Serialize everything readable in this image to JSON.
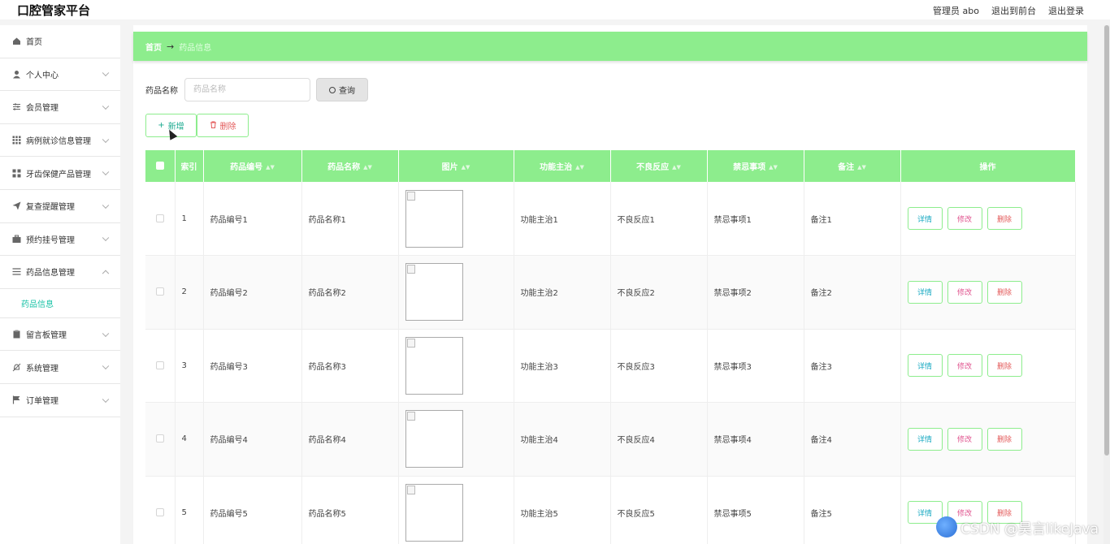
{
  "header": {
    "app_title": "口腔管家平台",
    "admin_label": "管理员 abo",
    "exit_front_label": "退出到前台",
    "logout_label": "退出登录"
  },
  "sidebar": {
    "items": [
      {
        "label": "首页",
        "icon": "home-icon",
        "chevron": false
      },
      {
        "label": "个人中心",
        "icon": "user-icon",
        "chevron": true
      },
      {
        "label": "会员管理",
        "icon": "sliders-icon",
        "chevron": true
      },
      {
        "label": "病例就诊信息管理",
        "icon": "grid-icon",
        "chevron": true
      },
      {
        "label": "牙齿保健产品管理",
        "icon": "blocks-icon",
        "chevron": true
      },
      {
        "label": "复查提醒管理",
        "icon": "send-icon",
        "chevron": true
      },
      {
        "label": "预约挂号管理",
        "icon": "briefcase-icon",
        "chevron": true
      },
      {
        "label": "药品信息管理",
        "icon": "list-icon",
        "chevron": true,
        "expanded": true
      },
      {
        "label": "留言板管理",
        "icon": "clipboard-icon",
        "chevron": true
      },
      {
        "label": "系统管理",
        "icon": "bell-off-icon",
        "chevron": true
      },
      {
        "label": "订单管理",
        "icon": "flag-icon",
        "chevron": true
      }
    ],
    "submenu_active": "药品信息"
  },
  "breadcrumb": {
    "home": "首页",
    "arrow": "→",
    "current": "药品信息"
  },
  "search": {
    "label": "药品名称",
    "placeholder": "药品名称",
    "value": "",
    "query_button": "查询"
  },
  "actions": {
    "add_label": "新增",
    "delete_label": "删除"
  },
  "table": {
    "headers": {
      "index": "索引",
      "code": "药品编号",
      "name": "药品名称",
      "image": "图片",
      "function": "功能主治",
      "adverse": "不良反应",
      "contraindication": "禁忌事项",
      "note": "备注",
      "ops": "操作"
    },
    "rows": [
      {
        "index": "1",
        "code": "药品编号1",
        "name": "药品名称1",
        "function": "功能主治1",
        "adverse": "不良反应1",
        "contraindication": "禁忌事项1",
        "note": "备注1"
      },
      {
        "index": "2",
        "code": "药品编号2",
        "name": "药品名称2",
        "function": "功能主治2",
        "adverse": "不良反应2",
        "contraindication": "禁忌事项2",
        "note": "备注2"
      },
      {
        "index": "3",
        "code": "药品编号3",
        "name": "药品名称3",
        "function": "功能主治3",
        "adverse": "不良反应3",
        "contraindication": "禁忌事项3",
        "note": "备注3"
      },
      {
        "index": "4",
        "code": "药品编号4",
        "name": "药品名称4",
        "function": "功能主治4",
        "adverse": "不良反应4",
        "contraindication": "禁忌事项4",
        "note": "备注4"
      },
      {
        "index": "5",
        "code": "药品编号5",
        "name": "药品名称5",
        "function": "功能主治5",
        "adverse": "不良反应5",
        "contraindication": "禁忌事项5",
        "note": "备注5"
      }
    ],
    "op_labels": {
      "detail": "详情",
      "edit": "修改",
      "remove": "删除"
    }
  },
  "watermark": {
    "text": "CSDN @昊言likeJava"
  },
  "colors": {
    "accent_green": "#8ded8d",
    "submenu_active": "#18c2a6",
    "danger": "#e35a5a"
  }
}
